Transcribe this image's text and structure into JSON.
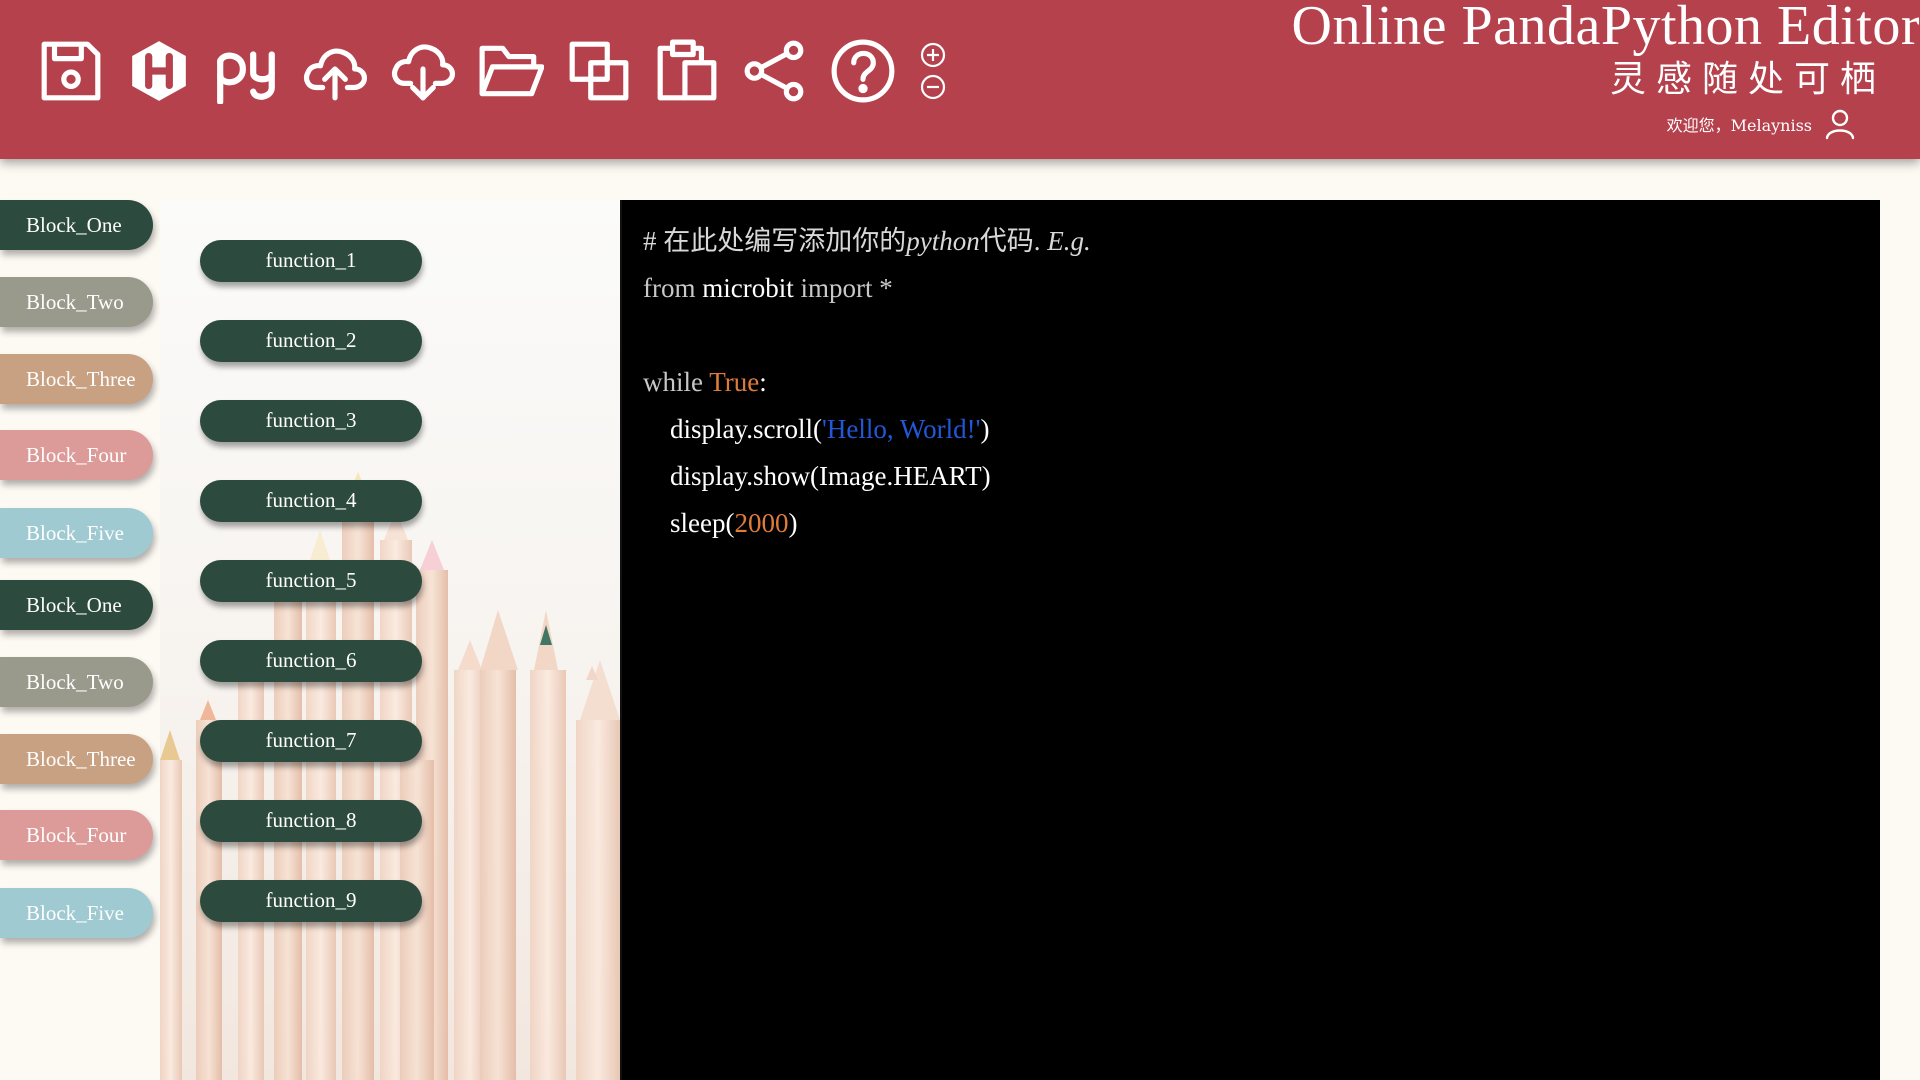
{
  "header": {
    "title": "Online PandaPython Editor",
    "subtitle": "灵感随处可栖",
    "welcome": "欢迎您，Melayniss",
    "background_color": "#b5414d",
    "toolbar_icons": [
      "save-icon",
      "hex-h-icon",
      "python-py-icon",
      "cloud-upload-icon",
      "cloud-download-icon",
      "folder-open-icon",
      "copy-icon",
      "paste-icon",
      "share-icon",
      "help-icon"
    ],
    "zoom_icons": [
      "zoom-in-icon",
      "zoom-out-icon"
    ]
  },
  "blocks": [
    {
      "label": "Block_One",
      "color": "#2c4a3e"
    },
    {
      "label": "Block_Two",
      "color": "#9a9a8c"
    },
    {
      "label": "Block_Three",
      "color": "#c8a182"
    },
    {
      "label": "Block_Four",
      "color": "#dc9a98"
    },
    {
      "label": "Block_Five",
      "color": "#9fcad2"
    },
    {
      "label": "Block_One",
      "color": "#2c4a3e"
    },
    {
      "label": "Block_Two",
      "color": "#9a9a8c"
    },
    {
      "label": "Block_Three",
      "color": "#c8a182"
    },
    {
      "label": "Block_Four",
      "color": "#dc9a98"
    },
    {
      "label": "Block_Five",
      "color": "#9fcad2"
    }
  ],
  "functions": [
    {
      "label": "function_1"
    },
    {
      "label": "function_2"
    },
    {
      "label": "function_3"
    },
    {
      "label": "function_4"
    },
    {
      "label": "function_5"
    },
    {
      "label": "function_6"
    },
    {
      "label": "function_7"
    },
    {
      "label": "function_8"
    },
    {
      "label": "function_9"
    }
  ],
  "editor": {
    "comment_hash": "#",
    "comment_text": " 在此处编写添加你的",
    "comment_python": "python",
    "comment_tail": "代码. ",
    "comment_eg": "E.g.",
    "line2_from": "from ",
    "line2_module": "microbit",
    "line2_import": " import *",
    "line4_while": "while ",
    "line4_true": "True",
    "line4_colon": ":",
    "line5_call": "    display.scroll(",
    "line5_string": "'Hello, World!'",
    "line5_close": ")",
    "line6": "    display.show(Image.HEART)",
    "line7_call": "    sleep(",
    "line7_number": "2000",
    "line7_close": ")"
  }
}
